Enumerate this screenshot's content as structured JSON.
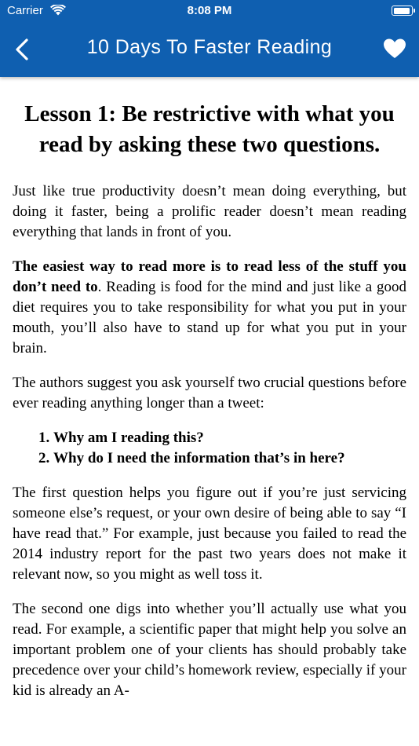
{
  "status_bar": {
    "carrier": "Carrier",
    "time": "8:08 PM"
  },
  "nav": {
    "title": "10 Days To Faster Reading",
    "back_icon": "chevron-left-icon",
    "favorite_icon": "heart-icon",
    "bar_color": "#0f5fb0"
  },
  "article": {
    "heading": "Lesson 1: Be restrictive with what you read by asking these two questions.",
    "p1": "Just like true productivity doesn’t mean doing everything, but doing it faster, being a prolific reader doesn’t mean reading everything that lands in front of you.",
    "p2_bold": "The easiest way to read more is to read less of the stuff you don’t need to",
    "p2_rest": ". Reading is food for the mind and just like a good diet requires you to take responsibility for what you put in your mouth, you’ll also have to stand up for what you put in your brain.",
    "p3": "The authors suggest you ask yourself two crucial questions before ever reading anything longer than a tweet:",
    "questions": [
      "Why am I reading this?",
      "Why do I need the information that’s in here?"
    ],
    "p4": "The first question helps you figure out if you’re just servicing someone else’s request, or your own desire of being able to say “I have read that.” For example, just because you failed to read the 2014 industry report for the past two years does not make it relevant now, so you might as well toss it.",
    "p5": "The second one digs into whether you’ll actually use what you read. For example, a scientific paper that might help you solve an important problem one of your clients has should probably take precedence over your child’s homework review, especially if your kid is already an A-"
  }
}
